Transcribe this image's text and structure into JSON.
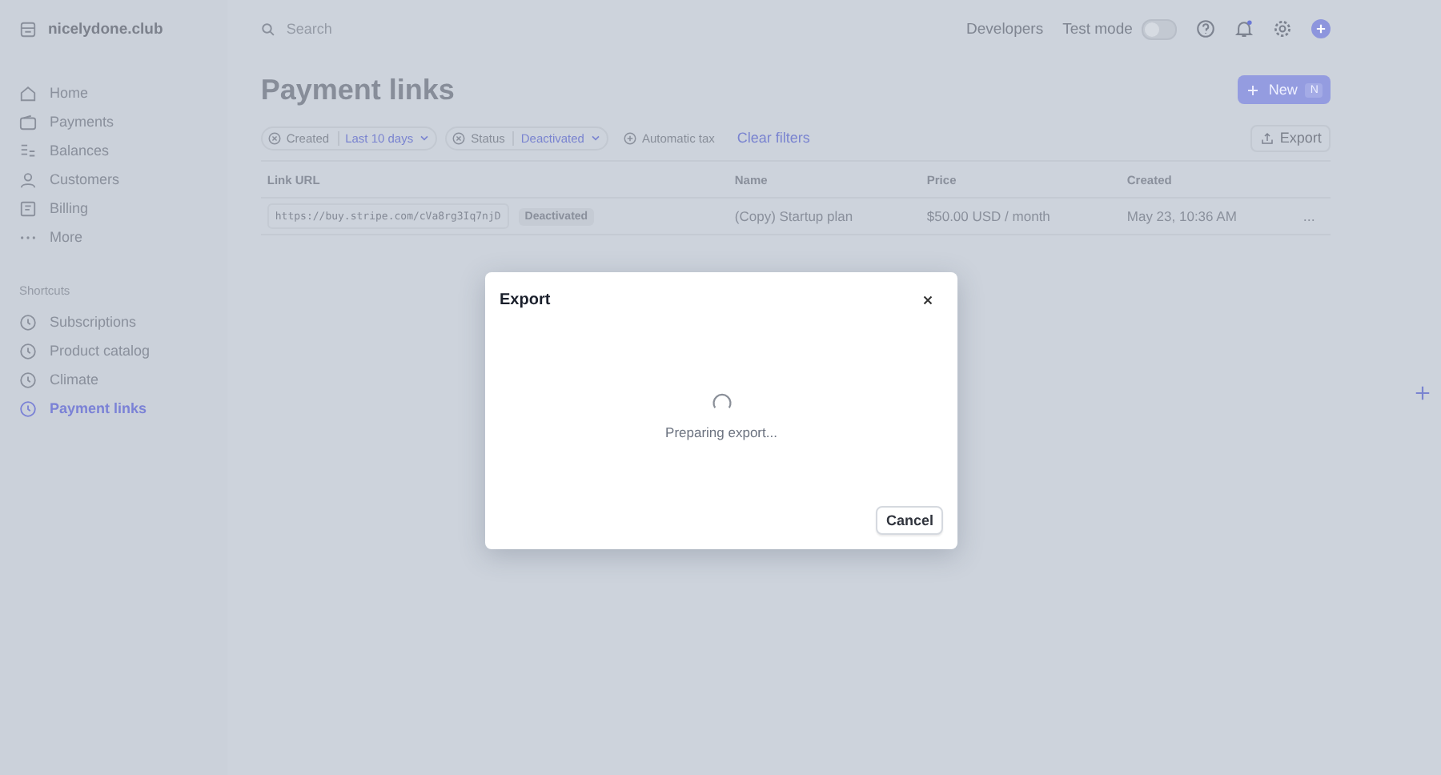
{
  "account": {
    "name": "nicelydone.club"
  },
  "sidebar": {
    "items": [
      {
        "label": "Home",
        "selected": false
      },
      {
        "label": "Payments",
        "selected": false
      },
      {
        "label": "Balances",
        "selected": false
      },
      {
        "label": "Customers",
        "selected": false
      },
      {
        "label": "Billing",
        "selected": false
      },
      {
        "label": "More",
        "selected": false
      }
    ],
    "shortcuts_title": "Shortcuts",
    "shortcuts": [
      {
        "label": "Subscriptions",
        "selected": false
      },
      {
        "label": "Product catalog",
        "selected": false
      },
      {
        "label": "Climate",
        "selected": false
      },
      {
        "label": "Payment links",
        "selected": true
      }
    ]
  },
  "topbar": {
    "search_placeholder": "Search",
    "developers": "Developers",
    "test_mode": {
      "label": "Test mode",
      "on": false
    }
  },
  "page": {
    "title": "Payment links",
    "new_button": {
      "label": "New",
      "shortcut": "N"
    },
    "export_button": "Export",
    "filters": [
      {
        "label": "Created",
        "value": "Last 10 days",
        "kind": "set"
      },
      {
        "label": "Status",
        "value": "Deactivated",
        "kind": "set"
      },
      {
        "label": "Automatic tax",
        "kind": "add"
      }
    ],
    "clear_filters": "Clear filters"
  },
  "table": {
    "columns": [
      "Link URL",
      "Name",
      "Price",
      "Created"
    ],
    "rows": [
      {
        "url": "https://buy.stripe.com/cVa8rg3Iq7njD",
        "status": "Deactivated",
        "name": "(Copy) Startup plan",
        "price": "$50.00 USD / month",
        "created": "May 23, 10:36 AM",
        "menu": "..."
      }
    ]
  },
  "dialog": {
    "title": "Export",
    "message": "Preparing export...",
    "cancel": "Cancel"
  }
}
